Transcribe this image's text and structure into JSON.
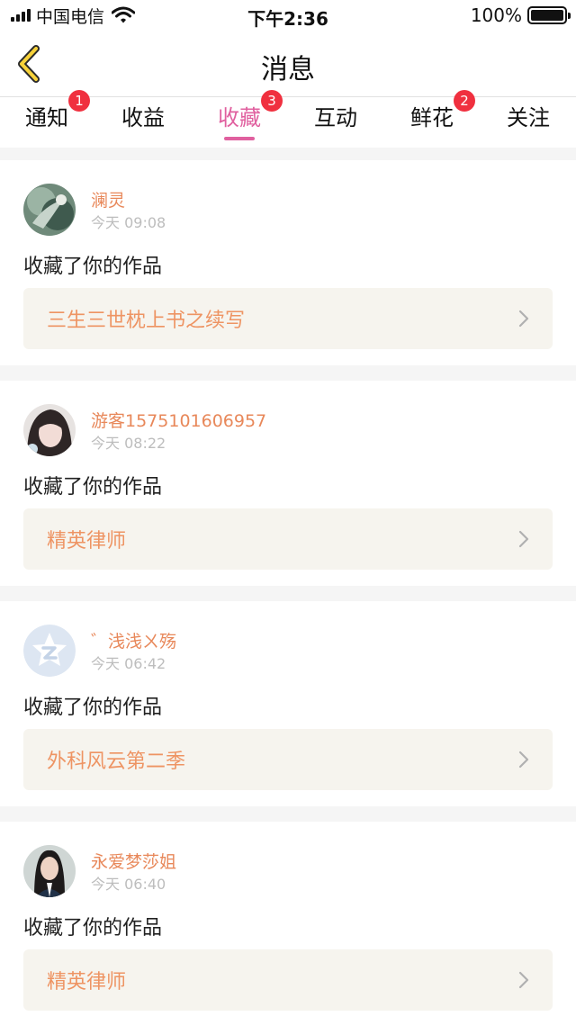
{
  "status_bar": {
    "carrier": "中国电信",
    "time": "下午2:36",
    "battery": "100%",
    "battery_level": 1.0
  },
  "nav": {
    "title": "消息",
    "back_icon": "chevron-left-icon"
  },
  "tabs": [
    {
      "label": "通知",
      "badge": "1",
      "active": false
    },
    {
      "label": "收益",
      "badge": "",
      "active": false
    },
    {
      "label": "收藏",
      "badge": "3",
      "active": true
    },
    {
      "label": "互动",
      "badge": "",
      "active": false
    },
    {
      "label": "鲜花",
      "badge": "2",
      "active": false
    },
    {
      "label": "关注",
      "badge": "",
      "active": false
    }
  ],
  "messages": [
    {
      "user": "澜灵",
      "time": "今天 09:08",
      "action": "收藏了你的作品",
      "work": "三生三世枕上书之续写"
    },
    {
      "user": "游客1575101606957",
      "time": "今天 08:22",
      "action": "收藏了你的作品",
      "work": "精英律师"
    },
    {
      "user": "゛浅浅ㄨ殇",
      "time": "今天 06:42",
      "action": "收藏了你的作品",
      "work": "外科风云第二季"
    },
    {
      "user": "永爱梦莎姐",
      "time": "今天 06:40",
      "action": "收藏了你的作品",
      "work": "精英律师"
    }
  ],
  "colors": {
    "accent_pink": "#e0609f",
    "badge_red": "#f0303f",
    "username_orange": "#e8885a",
    "work_title_orange": "#ee9463",
    "work_box_bg": "#f6f4ee"
  }
}
